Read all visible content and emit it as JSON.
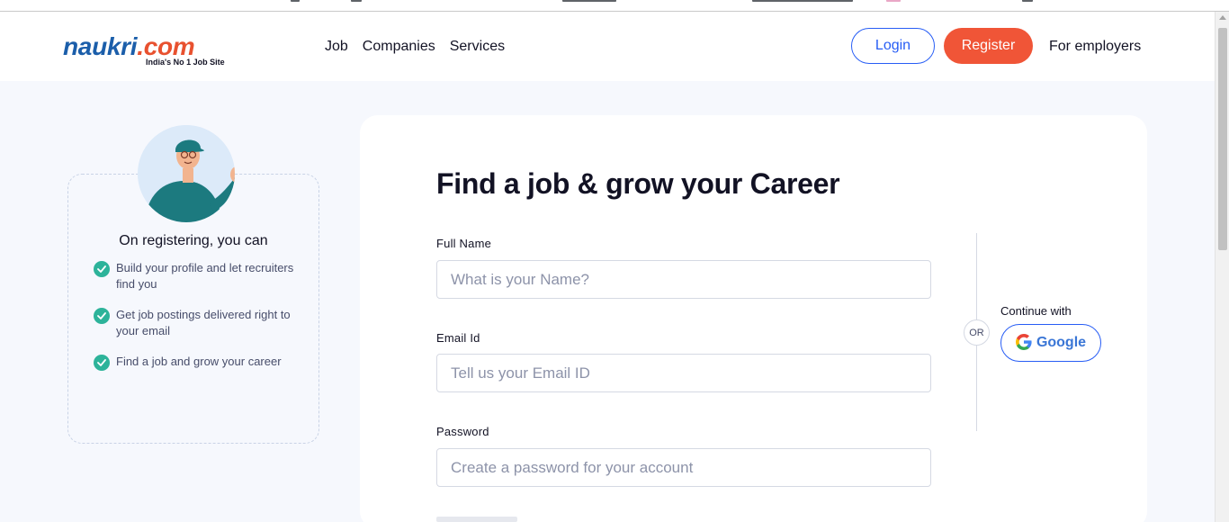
{
  "header": {
    "logo_text": "naukri",
    "logo_domain": ".com",
    "logo_tagline": "India's No 1 Job Site",
    "nav": [
      "Job",
      "Companies",
      "Services"
    ],
    "login_label": "Login",
    "register_label": "Register",
    "employers_label": "For employers"
  },
  "sidebar": {
    "title": "On registering, you can",
    "benefits": [
      "Build your profile and let recruiters find you",
      "Get job postings delivered right to your email",
      "Find a job and grow your career"
    ]
  },
  "form": {
    "title": "Find a job & grow your Career",
    "full_name_label": "Full Name",
    "full_name_placeholder": "What is your Name?",
    "email_label": "Email Id",
    "email_placeholder": "Tell us your Email ID",
    "password_label": "Password",
    "password_placeholder": "Create a password for your account"
  },
  "social": {
    "or_label": "OR",
    "continue_with": "Continue with",
    "google_label": "Google"
  },
  "colors": {
    "brand_blue": "#275df5",
    "register_orange": "#f05537",
    "check_green": "#2db39a",
    "page_bg": "#f6f8fd"
  },
  "icons": [
    "check-circle-icon",
    "google-icon",
    "avatar-illustration"
  ]
}
